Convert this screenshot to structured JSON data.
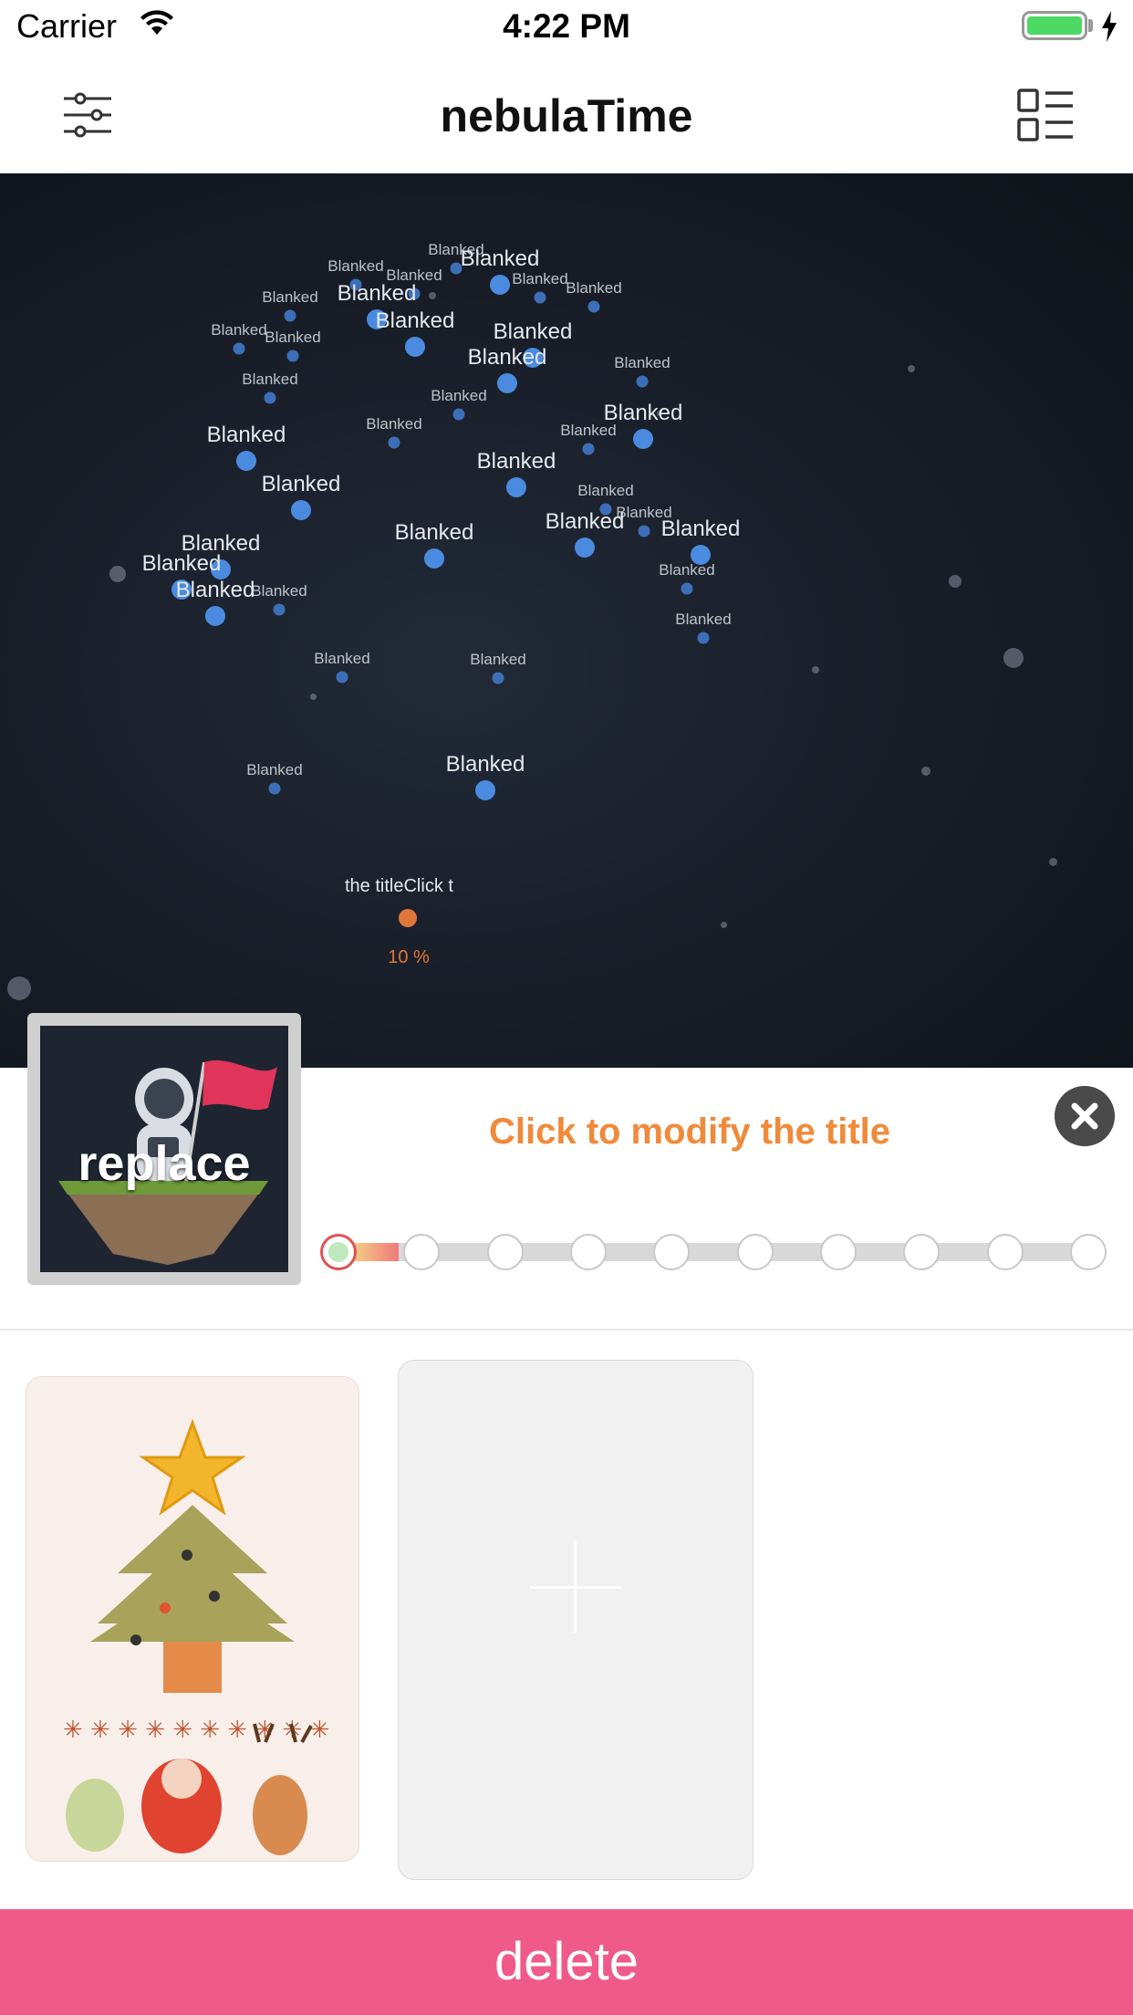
{
  "status_bar": {
    "carrier": "Carrier",
    "time": "4:22 PM",
    "battery_level": 1.0
  },
  "nav": {
    "title": "nebulaTime",
    "left_icon": "filter-sliders-icon",
    "right_icon": "list-view-icon"
  },
  "nebula": {
    "nodes": [
      {
        "label": "Blanked",
        "size": "s"
      },
      {
        "label": "Blanked",
        "size": "s"
      },
      {
        "label": "Blanked",
        "size": "l"
      },
      {
        "label": "Blanked",
        "size": "s"
      },
      {
        "label": "Blanked",
        "size": "s"
      },
      {
        "label": "Blanked",
        "size": "s"
      },
      {
        "label": "Blanked",
        "size": "l"
      },
      {
        "label": "Blanked",
        "size": "s"
      },
      {
        "label": "Blanked",
        "size": "s"
      },
      {
        "label": "Blanked",
        "size": "l"
      },
      {
        "label": "Blanked",
        "size": "s"
      },
      {
        "label": "Blanked",
        "size": "l"
      },
      {
        "label": "Blanked",
        "size": "s"
      },
      {
        "label": "Blanked",
        "size": "l"
      },
      {
        "label": "Blanked",
        "size": "s"
      },
      {
        "label": "Blanked",
        "size": "s"
      },
      {
        "label": "Blanked",
        "size": "l"
      },
      {
        "label": "Blanked",
        "size": "s"
      },
      {
        "label": "Blanked",
        "size": "l"
      },
      {
        "label": "Blanked",
        "size": "l"
      },
      {
        "label": "Blanked",
        "size": "l"
      },
      {
        "label": "Blanked",
        "size": "s"
      },
      {
        "label": "Blanked",
        "size": "s"
      },
      {
        "label": "Blanked",
        "size": "l"
      },
      {
        "label": "Blanked",
        "size": "s"
      },
      {
        "label": "Blanked",
        "size": "l"
      },
      {
        "label": "Blanked",
        "size": "l"
      },
      {
        "label": "Blanked",
        "size": "l"
      },
      {
        "label": "Blanked",
        "size": "s"
      },
      {
        "label": "Blanked",
        "size": "l"
      },
      {
        "label": "Blanked",
        "size": "s"
      },
      {
        "label": "Blanked",
        "size": "l"
      },
      {
        "label": "Blanked",
        "size": "s"
      },
      {
        "label": "Blanked",
        "size": "s"
      },
      {
        "label": "Blanked",
        "size": "s"
      },
      {
        "label": "Blanked",
        "size": "l"
      },
      {
        "label": "Blanked",
        "size": "s"
      }
    ],
    "clipped_title": "the titleClick t",
    "progress_label": "10 %"
  },
  "editor": {
    "thumbnail_label": "replace",
    "title_placeholder": "Click to modify the title",
    "close_icon": "close-icon",
    "progress_steps": 10,
    "progress_value": 0.1,
    "accent_color": "#f08a3a"
  },
  "cards": {
    "add_icon": "plus-icon"
  },
  "footer": {
    "delete_label": "delete",
    "color": "#ef5a8a"
  }
}
